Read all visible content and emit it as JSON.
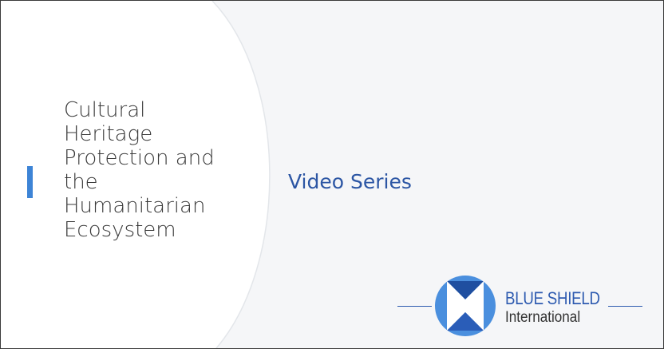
{
  "slide": {
    "title_lines": [
      "Cultural",
      "Heritage",
      "Protection and",
      "the",
      "Humanitarian",
      "Ecosystem"
    ],
    "subtitle": "Video Series"
  },
  "logo": {
    "name": "BLUE SHIELD",
    "sub": "International",
    "emblem_icon": "blue-shield-emblem-icon"
  },
  "colors": {
    "accent": "#3d84d6",
    "subtitle": "#2c56a4",
    "brand": "#2e5bb0",
    "brand_light": "#4a8fde"
  }
}
